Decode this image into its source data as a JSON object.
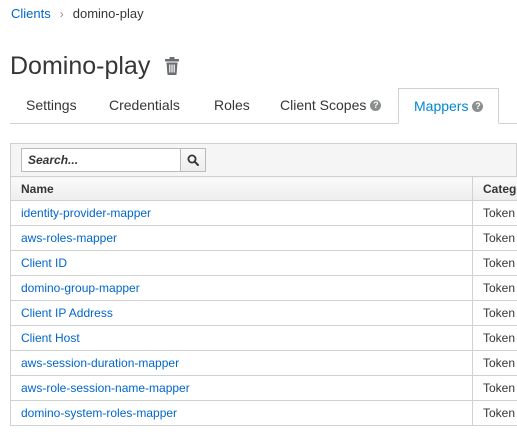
{
  "breadcrumb": {
    "parent": "Clients",
    "separator": "›",
    "current": "domino-play"
  },
  "page": {
    "title": "Domino-play",
    "delete_icon": "trash-icon"
  },
  "tabs": [
    {
      "label": "Settings",
      "active": false,
      "help": false
    },
    {
      "label": "Credentials",
      "active": false,
      "help": false
    },
    {
      "label": "Roles",
      "active": false,
      "help": false
    },
    {
      "label": "Client Scopes",
      "active": false,
      "help": true
    },
    {
      "label": "Mappers",
      "active": true,
      "help": true
    }
  ],
  "help_glyph": "?",
  "search": {
    "placeholder": "Search...",
    "value": "",
    "icon": "search-icon"
  },
  "table": {
    "columns": [
      "Name",
      "Category"
    ],
    "rows": [
      {
        "name": "identity-provider-mapper",
        "category": "Token mapper"
      },
      {
        "name": "aws-roles-mapper",
        "category": "Token mapper"
      },
      {
        "name": "Client ID",
        "category": "Token mapper"
      },
      {
        "name": "domino-group-mapper",
        "category": "Token mapper"
      },
      {
        "name": "Client IP Address",
        "category": "Token mapper"
      },
      {
        "name": "Client Host",
        "category": "Token mapper"
      },
      {
        "name": "aws-session-duration-mapper",
        "category": "Token mapper"
      },
      {
        "name": "aws-role-session-name-mapper",
        "category": "Token mapper"
      },
      {
        "name": "domino-system-roles-mapper",
        "category": "Token mapper"
      }
    ]
  },
  "colors": {
    "link": "#0066cc",
    "active_tab": "#0088ce",
    "border": "#d1d1d1"
  }
}
